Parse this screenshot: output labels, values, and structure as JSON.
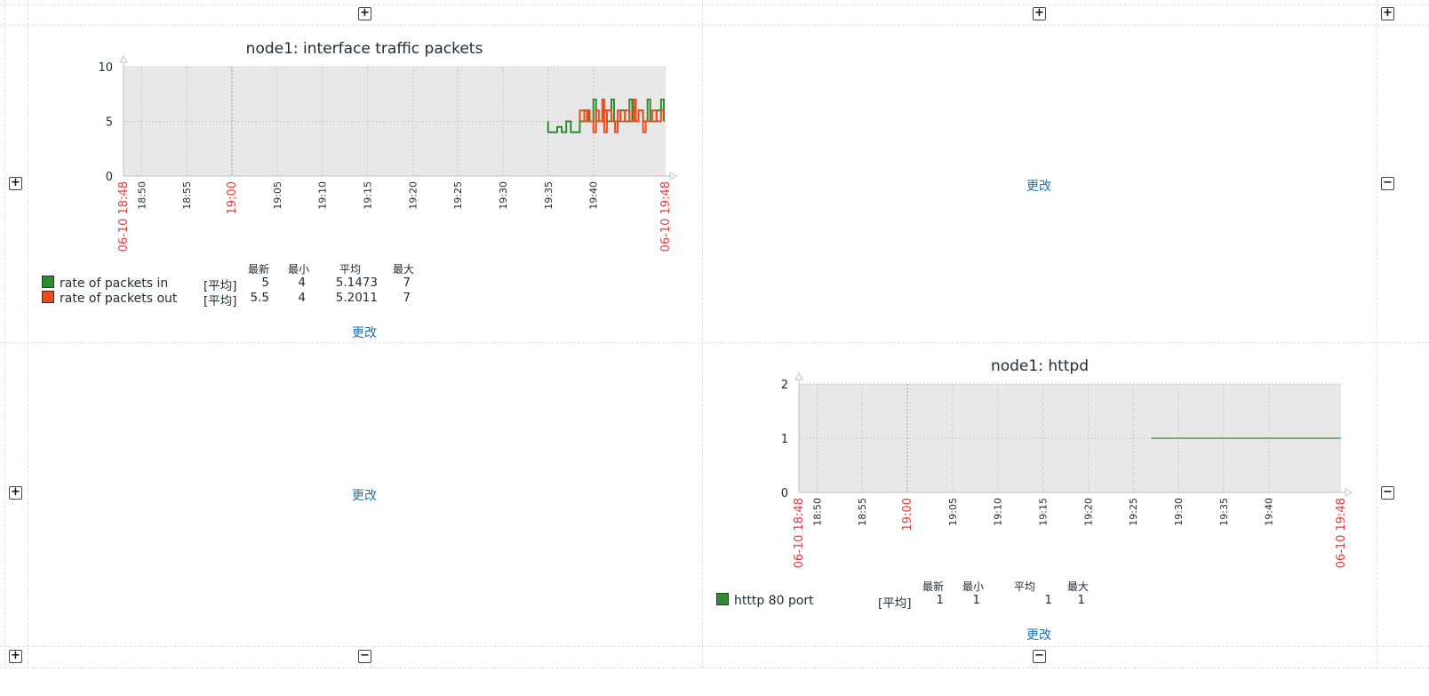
{
  "dashboard": {
    "change_label": "更改",
    "add_icon_glyph": "+",
    "remove_icon_glyph": "−"
  },
  "graphs": [
    {
      "title": "node1: interface traffic packets",
      "legend_headers": [
        "最新",
        "最小",
        "平均",
        "最大"
      ],
      "items": [
        {
          "name": "rate of packets in",
          "func": "[平均]",
          "color": "#2e8b2e",
          "values": [
            "5",
            "4",
            "5.1473",
            "7"
          ]
        },
        {
          "name": "rate of packets out",
          "func": "[平均]",
          "color": "#ee4a1a",
          "values": [
            "5.5",
            "4",
            "5.2011",
            "7"
          ]
        }
      ]
    },
    {
      "title": "node1: httpd",
      "legend_headers": [
        "最新",
        "最小",
        "平均",
        "最大"
      ],
      "items": [
        {
          "name": "htttp 80 port",
          "func": "[平均]",
          "color": "#2e8b2e",
          "values": [
            "1",
            "1",
            "1",
            "1"
          ]
        }
      ]
    }
  ],
  "chart_data": [
    {
      "type": "line",
      "title": "node1: interface traffic packets",
      "ylim": [
        0,
        10
      ],
      "yticks": [
        "0",
        "5",
        "10"
      ],
      "x_start_label": "06-10 18:48",
      "x_end_label": "06-10 19:48",
      "x_ticks": [
        "18:50",
        "18:55",
        "19:00",
        "19:05",
        "19:10",
        "19:15",
        "19:20",
        "19:25",
        "19:30",
        "19:35",
        "19:40"
      ],
      "highlight_tick": "19:00",
      "grid": true,
      "series": [
        {
          "name": "rate of packets in",
          "color": "#2e8b2e",
          "points": [
            [
              "19:35",
              5
            ],
            [
              "19:35",
              4
            ],
            [
              "19:36",
              4
            ],
            [
              "19:36",
              4.5
            ],
            [
              "19:36.5",
              4.5
            ],
            [
              "19:36.5",
              4
            ],
            [
              "19:37",
              4
            ],
            [
              "19:37",
              5
            ],
            [
              "19:37.5",
              5
            ],
            [
              "19:37.5",
              4
            ],
            [
              "19:38.5",
              4
            ],
            [
              "19:38.5",
              5
            ],
            [
              "19:39",
              5
            ],
            [
              "19:39",
              6
            ],
            [
              "19:39.5",
              6
            ],
            [
              "19:39.5",
              5
            ],
            [
              "19:40",
              5
            ],
            [
              "19:40",
              7
            ],
            [
              "19:40.3",
              7
            ],
            [
              "19:40.3",
              5
            ],
            [
              "19:41",
              5
            ],
            [
              "19:41",
              6
            ],
            [
              "19:41.5",
              6
            ],
            [
              "19:41.5",
              5
            ],
            [
              "19:42",
              5
            ],
            [
              "19:42",
              7
            ],
            [
              "19:42.3",
              7
            ],
            [
              "19:42.3",
              5
            ],
            [
              "19:43",
              5
            ],
            [
              "19:43",
              6
            ],
            [
              "19:43.5",
              6
            ],
            [
              "19:43.5",
              5
            ],
            [
              "19:44",
              5
            ],
            [
              "19:44",
              7
            ],
            [
              "19:44.3",
              7
            ],
            [
              "19:44.3",
              5
            ],
            [
              "19:45",
              5
            ],
            [
              "19:45",
              6
            ],
            [
              "19:45.5",
              6
            ],
            [
              "19:45.5",
              5
            ],
            [
              "19:46",
              5
            ],
            [
              "19:46",
              7
            ],
            [
              "19:46.3",
              7
            ],
            [
              "19:46.3",
              5
            ],
            [
              "19:47",
              5
            ],
            [
              "19:47",
              6
            ],
            [
              "19:47.5",
              6
            ],
            [
              "19:47.5",
              7
            ],
            [
              "19:47.8",
              7
            ],
            [
              "19:47.8",
              5
            ]
          ]
        },
        {
          "name": "rate of packets out",
          "color": "#ee4a1a",
          "points": [
            [
              "19:38.5",
              5
            ],
            [
              "19:38.5",
              6
            ],
            [
              "19:39",
              6
            ],
            [
              "19:39",
              5
            ],
            [
              "19:39.3",
              5
            ],
            [
              "19:39.3",
              6
            ],
            [
              "19:39.6",
              6
            ],
            [
              "19:39.6",
              5
            ],
            [
              "19:40",
              5
            ],
            [
              "19:40",
              4
            ],
            [
              "19:40.3",
              4
            ],
            [
              "19:40.3",
              6
            ],
            [
              "19:40.6",
              6
            ],
            [
              "19:40.6",
              5
            ],
            [
              "19:41",
              5
            ],
            [
              "19:41",
              7
            ],
            [
              "19:41.2",
              7
            ],
            [
              "19:41.2",
              4
            ],
            [
              "19:41.5",
              4
            ],
            [
              "19:41.5",
              6
            ],
            [
              "19:42",
              6
            ],
            [
              "19:42",
              5
            ],
            [
              "19:42.4",
              5
            ],
            [
              "19:42.4",
              4
            ],
            [
              "19:42.7",
              4
            ],
            [
              "19:42.7",
              6
            ],
            [
              "19:43",
              6
            ],
            [
              "19:43",
              5
            ],
            [
              "19:43.5",
              5
            ],
            [
              "19:43.5",
              6
            ],
            [
              "19:44",
              6
            ],
            [
              "19:44",
              5
            ],
            [
              "19:44.5",
              5
            ],
            [
              "19:44.5",
              7
            ],
            [
              "19:44.7",
              7
            ],
            [
              "19:44.7",
              5
            ],
            [
              "19:45",
              5
            ],
            [
              "19:45",
              6
            ],
            [
              "19:45.5",
              6
            ],
            [
              "19:45.5",
              4
            ],
            [
              "19:45.8",
              4
            ],
            [
              "19:45.8",
              5
            ],
            [
              "19:46.5",
              5
            ],
            [
              "19:46.5",
              6
            ],
            [
              "19:47",
              6
            ],
            [
              "19:47",
              5
            ],
            [
              "19:47.5",
              5
            ],
            [
              "19:47.5",
              6
            ],
            [
              "19:47.8",
              6
            ],
            [
              "19:47.8",
              5.5
            ]
          ]
        }
      ]
    },
    {
      "type": "line",
      "title": "node1: httpd",
      "ylim": [
        0,
        2
      ],
      "yticks": [
        "0",
        "1",
        "2"
      ],
      "x_start_label": "06-10 18:48",
      "x_end_label": "06-10 19:48",
      "x_ticks": [
        "18:50",
        "18:55",
        "19:00",
        "19:05",
        "19:10",
        "19:15",
        "19:20",
        "19:25",
        "19:30",
        "19:35",
        "19:40"
      ],
      "highlight_tick": "19:00",
      "grid": true,
      "series": [
        {
          "name": "htttp 80 port",
          "color": "#2e8b2e",
          "points": [
            [
              "19:27",
              1
            ],
            [
              "19:48",
              1
            ]
          ]
        }
      ]
    }
  ]
}
